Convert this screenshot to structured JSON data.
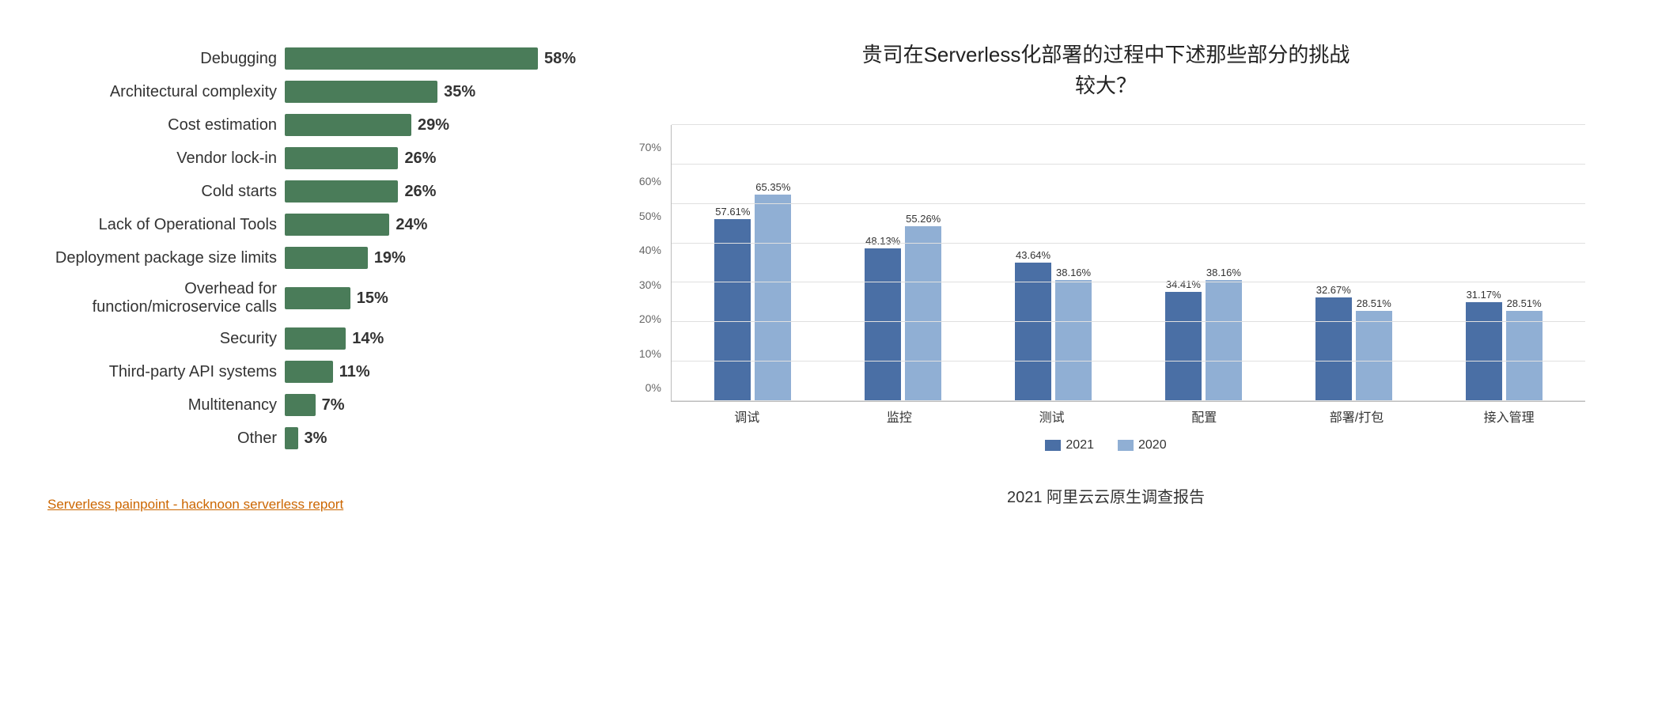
{
  "left": {
    "bars": [
      {
        "label": "Debugging",
        "pct": 58,
        "pct_label": "58%"
      },
      {
        "label": "Architectural complexity",
        "pct": 35,
        "pct_label": "35%"
      },
      {
        "label": "Cost estimation",
        "pct": 29,
        "pct_label": "29%"
      },
      {
        "label": "Vendor lock-in",
        "pct": 26,
        "pct_label": "26%"
      },
      {
        "label": "Cold starts",
        "pct": 26,
        "pct_label": "26%"
      },
      {
        "label": "Lack of Operational Tools",
        "pct": 24,
        "pct_label": "24%"
      },
      {
        "label": "Deployment package size limits",
        "pct": 19,
        "pct_label": "19%"
      },
      {
        "label": "Overhead for function/microservice calls",
        "pct": 15,
        "pct_label": "15%"
      },
      {
        "label": "Security",
        "pct": 14,
        "pct_label": "14%"
      },
      {
        "label": "Third-party API systems",
        "pct": 11,
        "pct_label": "11%"
      },
      {
        "label": "Multitenancy",
        "pct": 7,
        "pct_label": "7%"
      },
      {
        "label": "Other",
        "pct": 3,
        "pct_label": "3%"
      }
    ],
    "source_link": "Serverless painpoint - hacknoon serverless report",
    "max_pct": 58
  },
  "right": {
    "title_line1": "贵司在Serverless化部署的过程中下述那些部分的挑战",
    "title_line2": "较大？",
    "y_labels": [
      "0%",
      "10%",
      "20%",
      "30%",
      "40%",
      "50%",
      "60%",
      "70%"
    ],
    "groups": [
      {
        "label": "调试",
        "val_2021": 57.61,
        "val_2020": 65.35,
        "label_2021": "57.61%",
        "label_2020": "65.35%"
      },
      {
        "label": "监控",
        "val_2021": 48.13,
        "val_2020": 55.26,
        "label_2021": "48.13%",
        "label_2020": "55.26%"
      },
      {
        "label": "测试",
        "val_2021": 43.64,
        "val_2020": 38.16,
        "label_2021": "43.64%",
        "label_2020": "38.16%"
      },
      {
        "label": "配置",
        "val_2021": 34.41,
        "val_2020": 38.16,
        "label_2021": "34.41%",
        "label_2020": "38.16%"
      },
      {
        "label": "部署/打包",
        "val_2021": 32.67,
        "val_2020": 28.51,
        "label_2021": "32.67%",
        "label_2020": "28.51%"
      },
      {
        "label": "接入管理",
        "val_2021": 31.17,
        "val_2020": 28.51,
        "label_2021": "31.17%",
        "label_2020": "28.51%"
      }
    ],
    "legend": {
      "label_2021": "2021",
      "label_2020": "2020"
    },
    "source": "2021 阿里云云原生调查报告",
    "max_y": 70
  }
}
